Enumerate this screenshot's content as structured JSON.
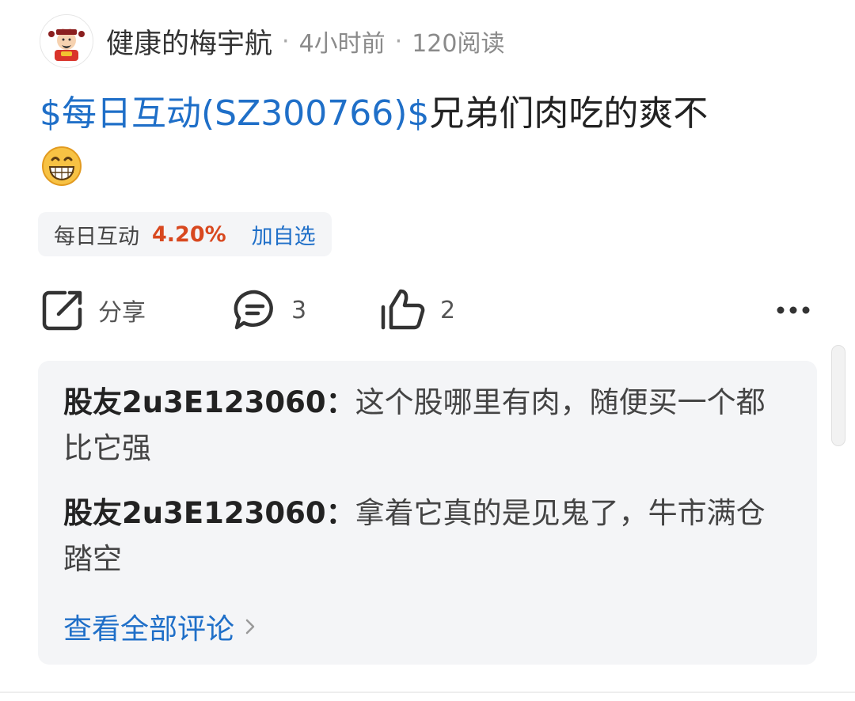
{
  "post": {
    "author": "健康的梅宇航",
    "time": "4小时前",
    "reads": "120阅读",
    "stock_tag": "$每日互动(SZ300766)$",
    "text": "兄弟们肉吃的爽不",
    "emoji_icon": "grinning-face-icon"
  },
  "stock_chip": {
    "name": "每日互动",
    "change": "4.20%",
    "add_label": "加自选"
  },
  "actions": {
    "share_label": "分享",
    "comment_count": "3",
    "like_count": "2"
  },
  "comments": [
    {
      "user": "股友2u3E123060",
      "separator": "：",
      "text": "这个股哪里有肉，随便买一个都比它强"
    },
    {
      "user": "股友2u3E123060",
      "separator": "：",
      "text": "拿着它真的是见鬼了，牛市满仓踏空"
    }
  ],
  "view_all_label": "查看全部评论",
  "colors": {
    "link_blue": "#1f6fc8",
    "rise_red": "#d8481f",
    "card_bg": "#f4f5f7"
  }
}
